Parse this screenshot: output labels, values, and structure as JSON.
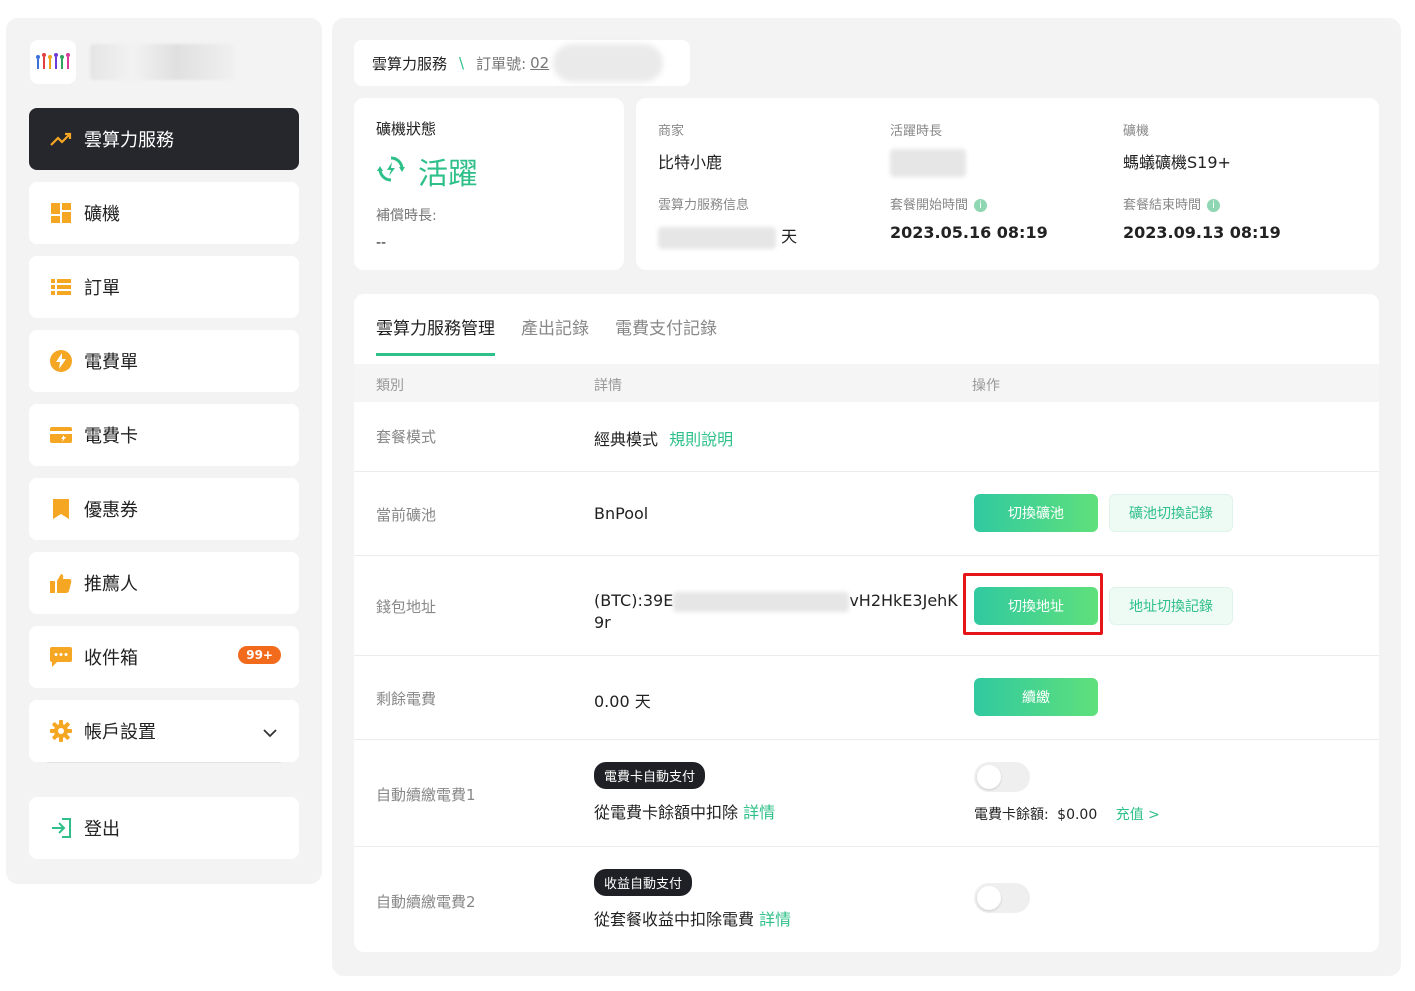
{
  "sidebar": {
    "items": [
      {
        "label": "雲算力服務",
        "icon": "trend-up-icon",
        "active": true
      },
      {
        "label": "礦機",
        "icon": "grid-icon"
      },
      {
        "label": "訂單",
        "icon": "list-icon"
      },
      {
        "label": "電費單",
        "icon": "lightning-icon"
      },
      {
        "label": "電費卡",
        "icon": "card-icon"
      },
      {
        "label": "優惠券",
        "icon": "bookmark-icon"
      },
      {
        "label": "推薦人",
        "icon": "thumbs-up-icon"
      },
      {
        "label": "收件箱",
        "icon": "message-icon",
        "badge": "99+"
      },
      {
        "label": "帳戶設置",
        "icon": "gear-icon"
      }
    ],
    "logout": "登出"
  },
  "breadcrumb": {
    "root": "雲算力服務",
    "separator": "\\",
    "order_label": "訂單號:",
    "order_value": "02"
  },
  "status": {
    "label": "礦機狀態",
    "value": "活躍",
    "compensation_label": "補償時長:",
    "compensation_value": "--"
  },
  "info": {
    "merchant_label": "商家",
    "merchant_value": "比特小鹿",
    "duration_label": "活躍時長",
    "miner_label": "礦機",
    "miner_value": "螞蟻礦機S19+",
    "service_info_label": "雲算力服務信息",
    "service_info_suffix": "天",
    "start_label": "套餐開始時間",
    "start_value": "2023.05.16 08:19",
    "end_label": "套餐結束時間",
    "end_value": "2023.09.13 08:19"
  },
  "tabs": [
    "雲算力服務管理",
    "產出記錄",
    "電費支付記錄"
  ],
  "table": {
    "headers": {
      "category": "類別",
      "details": "詳情",
      "actions": "操作"
    },
    "plan": {
      "category": "套餐模式",
      "value": "經典模式",
      "link": "規則說明"
    },
    "pool": {
      "category": "當前礦池",
      "value": "BnPool",
      "primary": "切換礦池",
      "secondary": "礦池切換記錄"
    },
    "wallet": {
      "category": "錢包地址",
      "prefix": "(BTC):39E",
      "suffix": "vH2HkE3JehK",
      "line2": "9r",
      "primary": "切換地址",
      "secondary": "地址切換記錄"
    },
    "remaining": {
      "category": "剩餘電費",
      "value": "0.00 天",
      "primary": "續繳"
    },
    "auto1": {
      "category": "自動續繳電費1",
      "tag": "電費卡自動支付",
      "desc": "從電費卡餘額中扣除",
      "link": "詳情",
      "balance_label": "電費卡餘額:",
      "balance_value": "$0.00",
      "recharge": "充值 >",
      "enabled": false
    },
    "auto2": {
      "category": "自動續繳電費2",
      "tag": "收益自動支付",
      "desc": "從套餐收益中扣除電費",
      "link": "詳情",
      "enabled": false
    }
  },
  "colors": {
    "accent": "#2fc089",
    "dark": "#26272d",
    "badge": "#f26b1d",
    "highlight": "#e5161a"
  }
}
